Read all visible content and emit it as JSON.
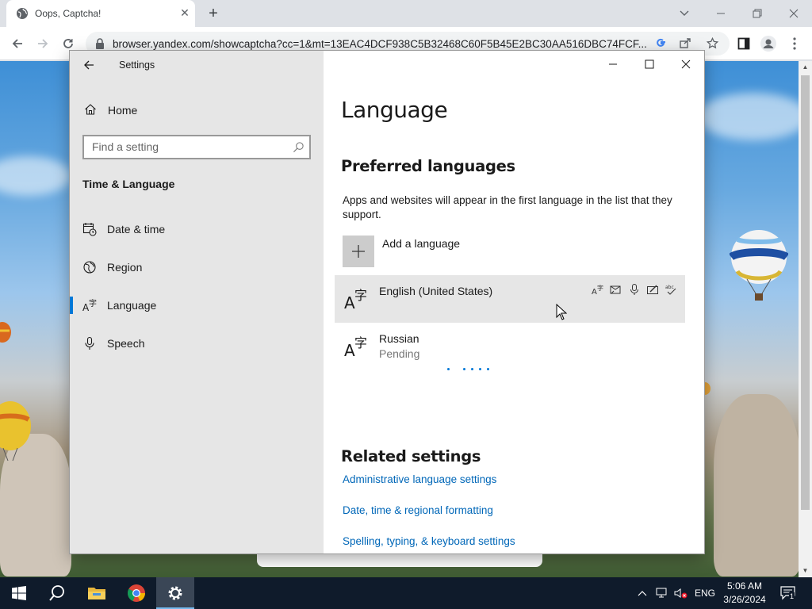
{
  "browser": {
    "tab_title": "Oops, Captcha!",
    "close_tab_glyph": "✕",
    "new_tab_glyph": "+",
    "url": "browser.yandex.com/showcaptcha?cc=1&mt=13EAC4DCF938C5B32468C60F5B45E2BC30AA516DBC74FCF...",
    "icons": [
      "back-arrow-icon",
      "forward-arrow-icon",
      "reload-icon",
      "lock-icon",
      "google-translate-icon",
      "share-icon",
      "star-icon",
      "side-panel-icon",
      "profile-icon",
      "menu-icon"
    ]
  },
  "settings": {
    "app_title": "Settings",
    "home_label": "Home",
    "search_placeholder": "Find a setting",
    "section_title": "Time & Language",
    "nav_items": [
      {
        "label": "Date & time"
      },
      {
        "label": "Region"
      },
      {
        "label": "Language"
      },
      {
        "label": "Speech"
      }
    ],
    "selected_nav": "Language",
    "accent_color": "#0078d7",
    "page_title": "Language",
    "preferred_heading": "Preferred languages",
    "preferred_desc": "Apps and websites will appear in the first language in the list that they support.",
    "add_language_label": "Add a language",
    "languages": [
      {
        "name": "English (United States)",
        "status": ""
      },
      {
        "name": "Russian",
        "status": "Pending"
      }
    ],
    "related_heading": "Related settings",
    "related_links": [
      "Administrative language settings",
      "Date, time & regional formatting",
      "Spelling, typing, & keyboard settings"
    ]
  },
  "taskbar": {
    "language": "ENG",
    "time": "5:06 AM",
    "date": "3/26/2024",
    "notification_count": "1",
    "apps": [
      "start-icon",
      "search-icon",
      "file-explorer-icon",
      "chrome-icon",
      "settings-icon"
    ]
  }
}
